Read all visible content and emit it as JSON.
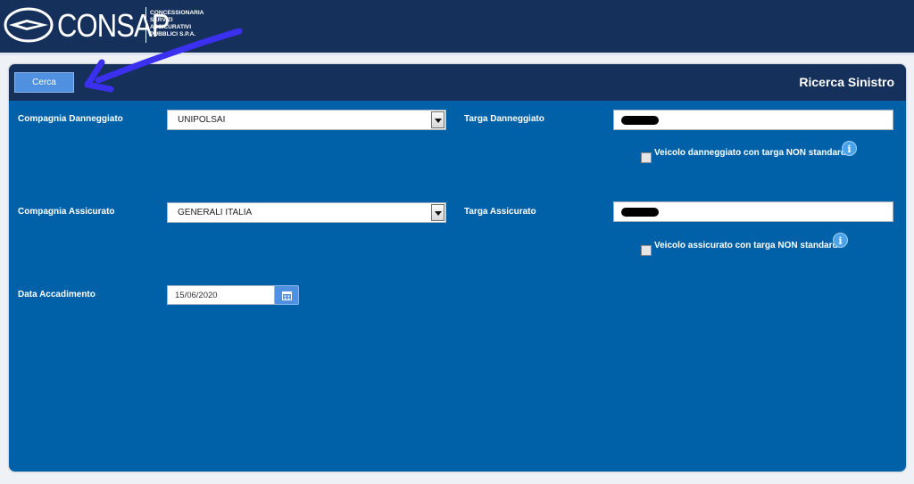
{
  "header": {
    "logo_name": "CONSAP",
    "logo_tagline": [
      "CONCESSIONARIA",
      "SERVIZI",
      "ASSICURATIVI",
      "PUBBLICI S.P.A."
    ]
  },
  "panel": {
    "title": "Ricerca Sinistro",
    "search_button": "Cerca"
  },
  "form": {
    "compagnia_danneggiato": {
      "label": "Compagnia Danneggiato",
      "value": "UNIPOLSAI"
    },
    "targa_danneggiato": {
      "label": "Targa Danneggiato",
      "value": "",
      "redacted": true
    },
    "nonstandard_danneggiato": {
      "label": "Veicolo danneggiato con targa NON standard",
      "checked": false
    },
    "compagnia_assicurato": {
      "label": "Compagnia Assicurato",
      "value": "GENERALI ITALIA"
    },
    "targa_assicurato": {
      "label": "Targa Assicurato",
      "value": "",
      "redacted": true
    },
    "nonstandard_assicurato": {
      "label": "Veicolo assicurato con targa NON standard",
      "checked": false
    },
    "data_accadimento": {
      "label": "Data Accadimento",
      "value": "15/06/2020"
    }
  },
  "icons": {
    "info": "info-icon",
    "calendar": "calendar-icon",
    "annotation": "arrow-icon"
  },
  "colors": {
    "header_bg": "#15305a",
    "panel_bg": "#0061a8",
    "button_bg": "#4f90e0",
    "annotation_arrow": "#3b2ff0"
  }
}
